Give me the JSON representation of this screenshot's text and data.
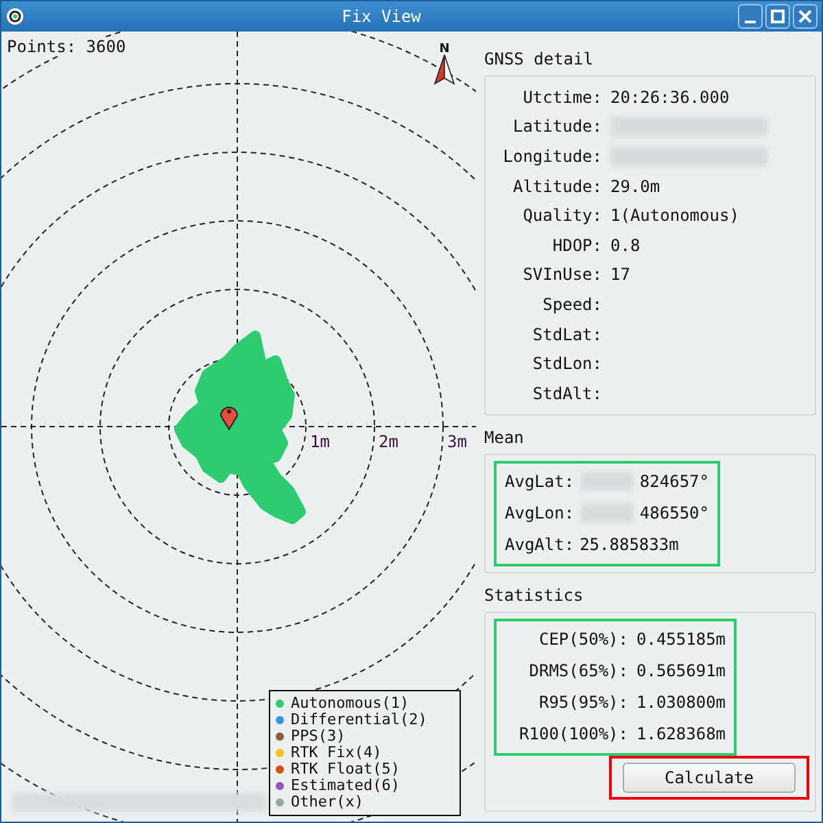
{
  "window": {
    "title": "Fix View"
  },
  "plot": {
    "points_label": "Points: 3600",
    "ring_labels": [
      "1m",
      "2m",
      "3m"
    ],
    "compass_label": "N",
    "legend": [
      {
        "label": "Autonomous(1)",
        "color": "#2ecc71"
      },
      {
        "label": "Differential(2)",
        "color": "#3498db"
      },
      {
        "label": "PPS(3)",
        "color": "#8e5a3c"
      },
      {
        "label": "RTK Fix(4)",
        "color": "#f1c40f"
      },
      {
        "label": "RTK Float(5)",
        "color": "#d35400"
      },
      {
        "label": "Estimated(6)",
        "color": "#9b59b6"
      },
      {
        "label": "Other(x)",
        "color": "#95a5a6"
      }
    ]
  },
  "gnss_detail": {
    "title": "GNSS detail",
    "rows": [
      {
        "label": "Utctime:",
        "kind": "text",
        "value": "20:26:36.000"
      },
      {
        "label": "Latitude:",
        "kind": "blurred"
      },
      {
        "label": "Longitude:",
        "kind": "blurred"
      },
      {
        "label": "Altitude:",
        "kind": "text",
        "value": "29.0m"
      },
      {
        "label": "Quality:",
        "kind": "text",
        "value": "1(Autonomous)"
      },
      {
        "label": "HDOP:",
        "kind": "text",
        "value": "0.8"
      },
      {
        "label": "SVInUse:",
        "kind": "text",
        "value": "17"
      },
      {
        "label": "Speed:",
        "kind": "text"
      },
      {
        "label": "StdLat:",
        "kind": "text"
      },
      {
        "label": "StdLon:",
        "kind": "text"
      },
      {
        "label": "StdAlt:",
        "kind": "text"
      }
    ]
  },
  "mean": {
    "title": "Mean",
    "rows": [
      {
        "label": "AvgLat:",
        "kind": "partly_blurred",
        "value": "824657°"
      },
      {
        "label": "AvgLon:",
        "kind": "partly_blurred",
        "value": "486550°"
      },
      {
        "label": "AvgAlt:",
        "kind": "text",
        "value": "25.885833m"
      }
    ]
  },
  "statistics": {
    "title": "Statistics",
    "rows": [
      {
        "label": "CEP(50%):",
        "value": "0.455185m"
      },
      {
        "label": "DRMS(65%):",
        "value": "0.565691m"
      },
      {
        "label": "R95(95%):",
        "value": "1.030800m"
      },
      {
        "label": "R100(100%):",
        "value": "1.628368m"
      }
    ],
    "button": "Calculate"
  }
}
